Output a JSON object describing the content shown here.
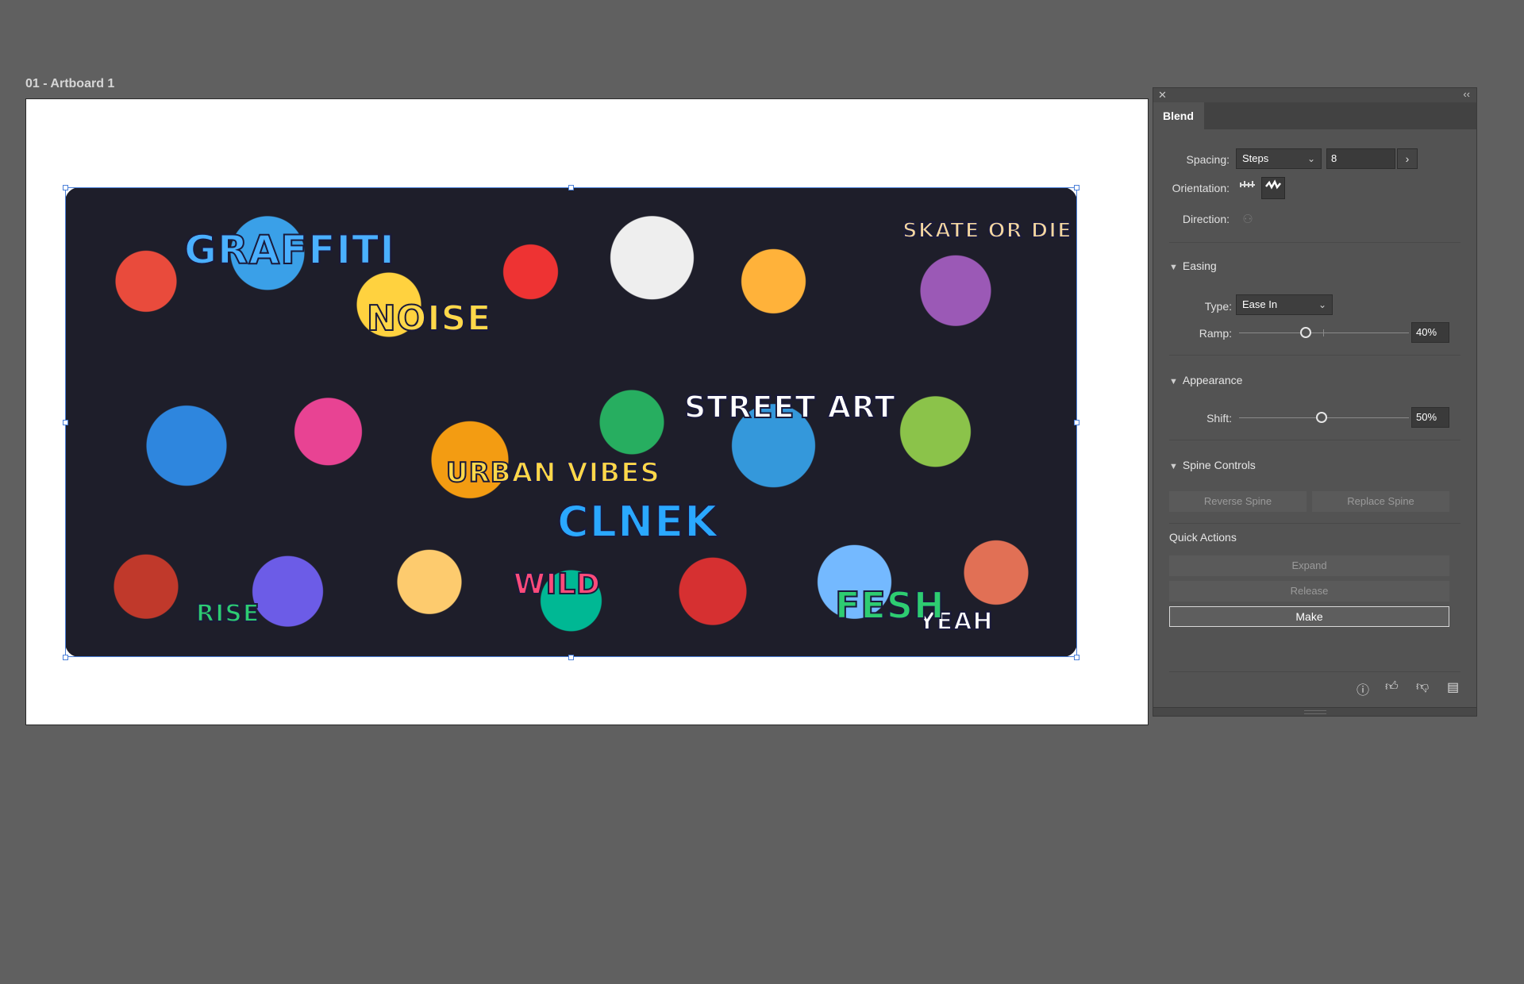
{
  "artboard": {
    "label": "01 - Artboard 1",
    "art_words": [
      "GRAFFITI",
      "NOISE",
      "SKATE OR DIE",
      "STREET ART",
      "URBAN VIBES",
      "CLNEK",
      "WILD",
      "RISE",
      "YEAH",
      "FESH"
    ]
  },
  "panel": {
    "tab": "Blend",
    "close_icon": "close-icon",
    "collapse_icon": "double-chevron-left-icon",
    "spacing": {
      "label": "Spacing:",
      "mode": "Steps",
      "value": "8"
    },
    "orientation": {
      "label": "Orientation:"
    },
    "direction": {
      "label": "Direction:"
    },
    "easing": {
      "title": "Easing",
      "type_label": "Type:",
      "type_value": "Ease In",
      "ramp_label": "Ramp:",
      "ramp_value": "40%"
    },
    "appearance": {
      "title": "Appearance",
      "shift_label": "Shift:",
      "shift_value": "50%"
    },
    "spine": {
      "title": "Spine Controls",
      "reverse": "Reverse Spine",
      "replace": "Replace Spine"
    },
    "quick_actions": {
      "title": "Quick Actions",
      "expand": "Expand",
      "release": "Release",
      "make": "Make"
    },
    "footer_icons": [
      "info-icon",
      "thumbs-up-icon",
      "thumbs-down-icon",
      "comment-icon"
    ]
  },
  "colors": {
    "workspace": "#606060",
    "panel": "#535353",
    "selection": "#4a7fd8"
  }
}
